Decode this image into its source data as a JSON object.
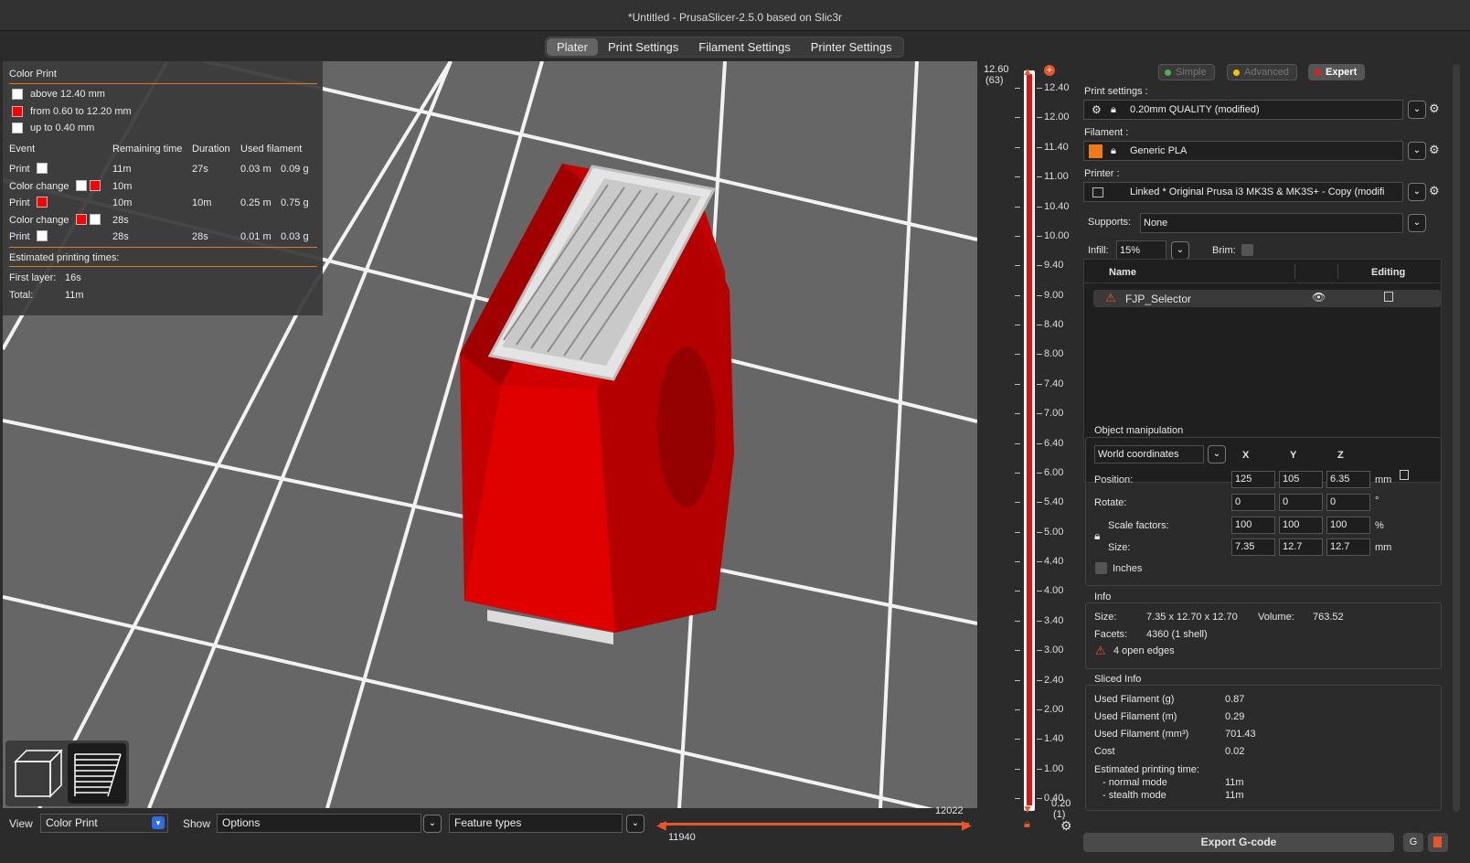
{
  "window": {
    "title": "*Untitled - PrusaSlicer-2.5.0 based on Slic3r"
  },
  "tabs": [
    "Plater",
    "Print Settings",
    "Filament Settings",
    "Printer Settings"
  ],
  "legend": {
    "title": "Color Print",
    "ranges": [
      {
        "label": "above 12.40 mm",
        "color": "#ffffff"
      },
      {
        "label": "from 0.60 to 12.20 mm",
        "color": "#ff0000"
      },
      {
        "label": "up to 0.40 mm",
        "color": "#ffffff"
      }
    ],
    "headers": [
      "Event",
      "Remaining time",
      "Duration",
      "Used filament"
    ],
    "events": [
      {
        "event": "Print",
        "colors": [
          "#ffffff"
        ],
        "remaining": "11m",
        "duration": "27s",
        "meters": "0.03 m",
        "grams": "0.09 g"
      },
      {
        "event": "Color change",
        "colors": [
          "#ffffff",
          "#ff0000"
        ],
        "remaining": "10m",
        "duration": "",
        "meters": "",
        "grams": ""
      },
      {
        "event": "Print",
        "colors": [
          "#ff0000"
        ],
        "remaining": "10m",
        "duration": "10m",
        "meters": "0.25 m",
        "grams": "0.75 g"
      },
      {
        "event": "Color change",
        "colors": [
          "#ff0000",
          "#ffffff"
        ],
        "remaining": "28s",
        "duration": "",
        "meters": "",
        "grams": ""
      },
      {
        "event": "Print",
        "colors": [
          "#ffffff"
        ],
        "remaining": "28s",
        "duration": "28s",
        "meters": "0.01 m",
        "grams": "0.03 g"
      }
    ],
    "est_title": "Estimated printing times:",
    "first_layer_label": "First layer:",
    "first_layer_value": "16s",
    "total_label": "Total:",
    "total_value": "11m"
  },
  "bottom": {
    "view_label": "View",
    "view_value": "Color Print",
    "show_label": "Show",
    "show_value": "Options",
    "feature_value": "Feature types",
    "hslider_top": "12022",
    "hslider_bottom": "11940"
  },
  "vslider": {
    "top_value": "12.60",
    "top_layer": "(63)",
    "bottom_value": "0.20",
    "bottom_layer": "(1)",
    "ticks": [
      "12.40",
      "12.00",
      "11.40",
      "11.00",
      "10.40",
      "10.00",
      "9.40",
      "9.00",
      "8.40",
      "8.00",
      "7.40",
      "7.00",
      "6.40",
      "6.00",
      "5.40",
      "5.00",
      "4.40",
      "4.00",
      "3.40",
      "3.00",
      "2.40",
      "2.00",
      "1.40",
      "1.00",
      "0.40"
    ]
  },
  "modes": {
    "simple": "Simple",
    "advanced": "Advanced",
    "expert": "Expert"
  },
  "print_settings": {
    "label": "Print settings :",
    "value": "0.20mm QUALITY (modified)"
  },
  "filament": {
    "label": "Filament :",
    "value": "Generic PLA",
    "color": "#f07a1a"
  },
  "printer": {
    "label": "Printer :",
    "value": "Linked * Original Prusa i3 MK3S & MK3S+ - Copy (modifi"
  },
  "supports": {
    "label": "Supports:",
    "value": "None"
  },
  "infill": {
    "label": "Infill:",
    "value": "15%"
  },
  "brim": {
    "label": "Brim:"
  },
  "object_list": {
    "name_header": "Name",
    "editing_header": "Editing",
    "object_name": "FJP_Selector"
  },
  "object_manipulation": {
    "title": "Object manipulation",
    "coords": "World coordinates",
    "axes": [
      "X",
      "Y",
      "Z"
    ],
    "position": {
      "label": "Position:",
      "values": [
        "125",
        "105",
        "6.35"
      ],
      "unit": "mm"
    },
    "rotate": {
      "label": "Rotate:",
      "values": [
        "0",
        "0",
        "0"
      ],
      "unit": "°"
    },
    "scale": {
      "label": "Scale factors:",
      "values": [
        "100",
        "100",
        "100"
      ],
      "unit": "%"
    },
    "size": {
      "label": "Size:",
      "values": [
        "7.35",
        "12.7",
        "12.7"
      ],
      "unit": "mm"
    },
    "inches_label": "Inches"
  },
  "info": {
    "title": "Info",
    "size_label": "Size:",
    "size_value": "7.35 x 12.70 x 12.70",
    "volume_label": "Volume:",
    "volume_value": "763.52",
    "facets_label": "Facets:",
    "facets_value": "4360 (1 shell)",
    "warning": "4 open edges"
  },
  "sliced_info": {
    "title": "Sliced Info",
    "rows": [
      {
        "label": "Used Filament (g)",
        "value": "0.87"
      },
      {
        "label": "Used Filament (m)",
        "value": "0.29"
      },
      {
        "label": "Used Filament (mm³)",
        "value": "701.43"
      },
      {
        "label": "Cost",
        "value": "0.02"
      }
    ],
    "est_label": "Estimated printing time:",
    "normal_label": "- normal mode",
    "normal_value": "11m",
    "stealth_label": "- stealth mode",
    "stealth_value": "11m"
  },
  "export_button": "Export G-code"
}
